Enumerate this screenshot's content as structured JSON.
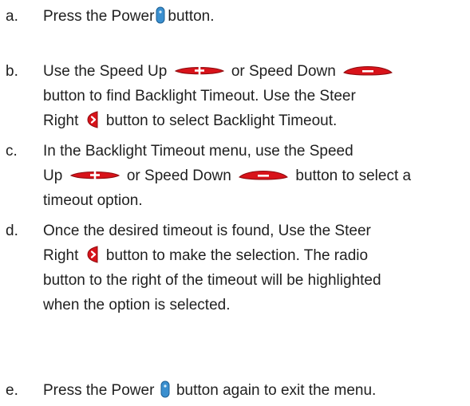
{
  "steps": [
    {
      "marker": "a.",
      "line1_pre": "Press the Power",
      "line1_post": "button."
    },
    {
      "marker": "b.",
      "line1_pre": "Use the Speed Up",
      "line1_mid": "or Speed Down",
      "line2": "button to find Backlight Timeout. Use the Steer",
      "line3_pre": "Right",
      "line3_post": "button to select Backlight Timeout."
    },
    {
      "marker": "c.",
      "line1": "In the Backlight Timeout menu, use the Speed",
      "line2_pre": "Up",
      "line2_mid": "or Speed Down",
      "line2_post": "button to select a",
      "line3": "timeout option."
    },
    {
      "marker": "d.",
      "line1": "Once the desired timeout is found, Use the Steer",
      "line2_pre": "Right",
      "line2_post": "button to make the selection. The radio",
      "line3": "button to the right of the timeout will be highlighted",
      "line4": "when the option is selected."
    },
    {
      "marker": "e.",
      "line1_pre": "Press the Power",
      "line1_post": "button again to exit the menu."
    }
  ],
  "icons": {
    "power": "power-button-icon",
    "speed_up": "speed-up-button-icon",
    "speed_down": "speed-down-button-icon",
    "steer_right": "steer-right-button-icon"
  },
  "colors": {
    "power_button": "#3a8fcf",
    "speed_button": "#d8131a",
    "steer_button": "#d8131a",
    "text": "#1f1f1f"
  }
}
